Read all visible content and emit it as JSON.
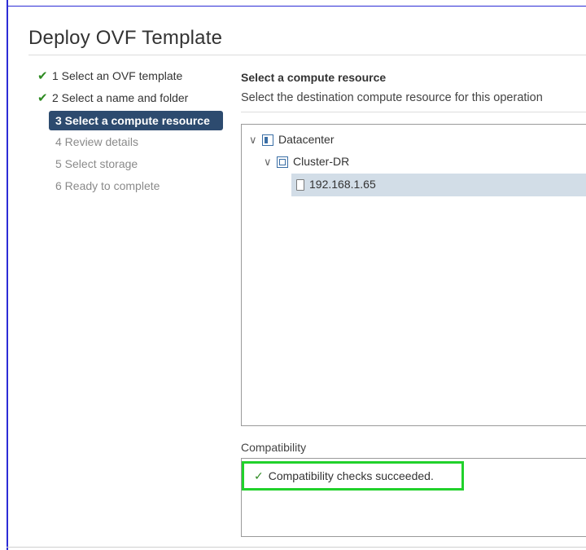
{
  "dialog": {
    "title": "Deploy OVF Template"
  },
  "steps": [
    {
      "label": "1 Select an OVF template",
      "state": "done"
    },
    {
      "label": "2 Select a name and folder",
      "state": "done"
    },
    {
      "label": "3 Select a compute resource",
      "state": "active"
    },
    {
      "label": "4 Review details",
      "state": "pending"
    },
    {
      "label": "5 Select storage",
      "state": "pending"
    },
    {
      "label": "6 Ready to complete",
      "state": "pending"
    }
  ],
  "section": {
    "title": "Select a compute resource",
    "description": "Select the destination compute resource for this operation"
  },
  "tree": {
    "datacenter": {
      "label": "Datacenter",
      "icon": "datacenter-icon",
      "expanded": true
    },
    "cluster": {
      "label": "Cluster-DR",
      "icon": "cluster-icon",
      "expanded": true
    },
    "host": {
      "label": "192.168.1.65",
      "icon": "host-icon",
      "selected": true
    }
  },
  "compatibility": {
    "label": "Compatibility",
    "message": "Compatibility checks succeeded.",
    "status_icon": "check-icon",
    "highlight_color": "#21d12b"
  },
  "colors": {
    "active_step_bg": "#2d4b6f",
    "check_green": "#2e8b22",
    "selected_row_bg": "#d2dde7"
  }
}
